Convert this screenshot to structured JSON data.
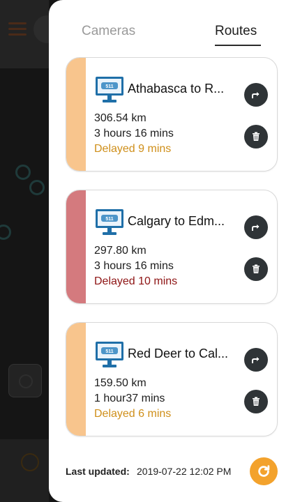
{
  "colors": {
    "delay_minor_bar": "#f8c58d",
    "delay_major_bar": "#d47a7e",
    "delay_minor_text": "#cf8f1a",
    "delay_major_text": "#8e1414",
    "action_button": "#2f3437",
    "refresh_button": "#f3a22c"
  },
  "tabs": [
    {
      "label": "Cameras",
      "active": false
    },
    {
      "label": "Routes",
      "active": true
    }
  ],
  "routes": [
    {
      "icon": "511-monitor-icon",
      "icon_text": "511",
      "title": "Athabasca to R...",
      "distance": "306.54 km",
      "duration": "3 hours 16 mins",
      "delay": "Delayed 9 mins",
      "severity": "minor"
    },
    {
      "icon": "511-monitor-icon",
      "icon_text": "511",
      "title": "Calgary to Edm...",
      "distance": "297.80 km",
      "duration": "3 hours 16 mins",
      "delay": "Delayed 10 mins",
      "severity": "major"
    },
    {
      "icon": "511-monitor-icon",
      "icon_text": "511",
      "title": "Red Deer to Cal...",
      "distance": "159.50 km",
      "duration": "1 hour37 mins",
      "delay": "Delayed 6 mins",
      "severity": "minor"
    }
  ],
  "footer": {
    "label": "Last updated:",
    "value": "2019-07-22 12:02 PM"
  }
}
